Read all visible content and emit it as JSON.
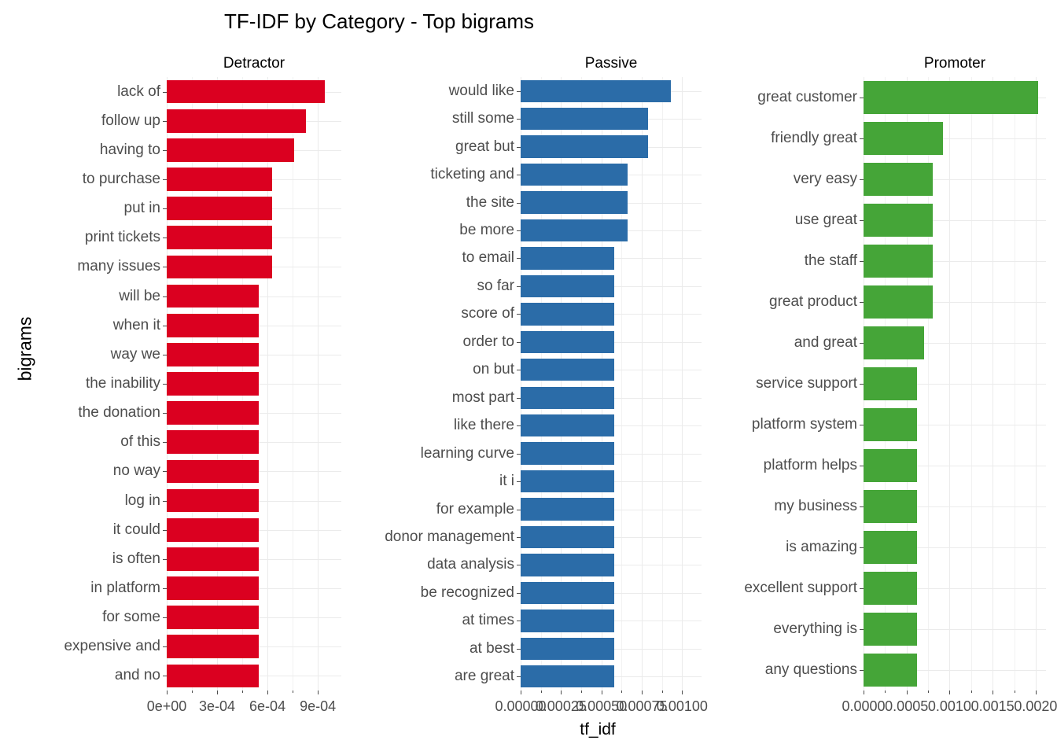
{
  "chart_data": {
    "type": "bar",
    "title": "TF-IDF by Category - Top bigrams",
    "xlabel": "tf_idf",
    "ylabel": "bigrams",
    "orientation": "horizontal",
    "grid": true,
    "legend": "none",
    "facets": [
      {
        "name": "Detractor",
        "color": "#DB0020",
        "xlim": [
          0,
          0.00104
        ],
        "ticks": [
          {
            "value": 0,
            "label": "0e+00"
          },
          {
            "value": 0.0003,
            "label": "3e-04"
          },
          {
            "value": 0.0006,
            "label": "6e-04"
          },
          {
            "value": 0.0009,
            "label": "9e-04"
          }
        ],
        "minor_ticks": [
          0.00015,
          0.00045,
          0.00075,
          0.00105
        ],
        "categories": [
          "lack of",
          "follow up",
          "having to",
          "to purchase",
          "put in",
          "print tickets",
          "many issues",
          "will be",
          "when it",
          "way we",
          "the inability",
          "the donation",
          "of this",
          "no way",
          "log in",
          "it could",
          "is often",
          "in platform",
          "for some",
          "expensive and",
          "and no"
        ],
        "values": [
          0.00094,
          0.000827,
          0.00076,
          0.00063,
          0.00063,
          0.00063,
          0.00063,
          0.000549,
          0.000549,
          0.000549,
          0.000549,
          0.000549,
          0.000549,
          0.000549,
          0.000549,
          0.000549,
          0.000549,
          0.000549,
          0.000549,
          0.000549,
          0.000549
        ]
      },
      {
        "name": "Passive",
        "color": "#2B6CA8",
        "xlim": [
          0,
          0.00112
        ],
        "ticks": [
          {
            "value": 0,
            "label": "0.00000"
          },
          {
            "value": 0.00025,
            "label": "0.00025"
          },
          {
            "value": 0.0005,
            "label": "0.00050"
          },
          {
            "value": 0.00075,
            "label": "0.00075"
          },
          {
            "value": 0.001,
            "label": "0.00100"
          }
        ],
        "minor_ticks": [
          0.000125,
          0.000375,
          0.000625,
          0.000875,
          0.001125
        ],
        "categories": [
          "would like",
          "still some",
          "great but",
          "ticketing and",
          "the site",
          "be more",
          "to email",
          "so far",
          "score of",
          "order to",
          "on but",
          "most part",
          "like there",
          "learning curve",
          "it i",
          "for example",
          "donor management",
          "data analysis",
          "be recognized",
          "at times",
          "at best",
          "are great"
        ],
        "values": [
          0.00093,
          0.00079,
          0.00079,
          0.00066,
          0.00066,
          0.00066,
          0.00058,
          0.00058,
          0.00058,
          0.00058,
          0.00058,
          0.00058,
          0.00058,
          0.00058,
          0.00058,
          0.00058,
          0.00058,
          0.00058,
          0.00058,
          0.00058,
          0.00058,
          0.00058
        ]
      },
      {
        "name": "Promoter",
        "color": "#45A538",
        "xlim": [
          0,
          0.00212
        ],
        "ticks": [
          {
            "value": 0,
            "label": "0.0000"
          },
          {
            "value": 0.0005,
            "label": "0.0005"
          },
          {
            "value": 0.001,
            "label": "0.0010"
          },
          {
            "value": 0.0015,
            "label": "0.0015"
          },
          {
            "value": 0.002,
            "label": "0.0020"
          }
        ],
        "minor_ticks": [
          0.00025,
          0.00075,
          0.00125,
          0.00175
        ],
        "categories": [
          "great customer",
          "friendly great",
          "very easy",
          "use great",
          "the staff",
          "great product",
          "and great",
          "service support",
          "platform system",
          "platform helps",
          "my business",
          "is amazing",
          "excellent support",
          "everything is",
          "any questions"
        ],
        "values": [
          0.00203,
          0.00092,
          0.0008,
          0.0008,
          0.0008,
          0.0008,
          0.0007,
          0.00062,
          0.00062,
          0.00062,
          0.00062,
          0.00062,
          0.00062,
          0.00062,
          0.00062
        ]
      }
    ]
  }
}
